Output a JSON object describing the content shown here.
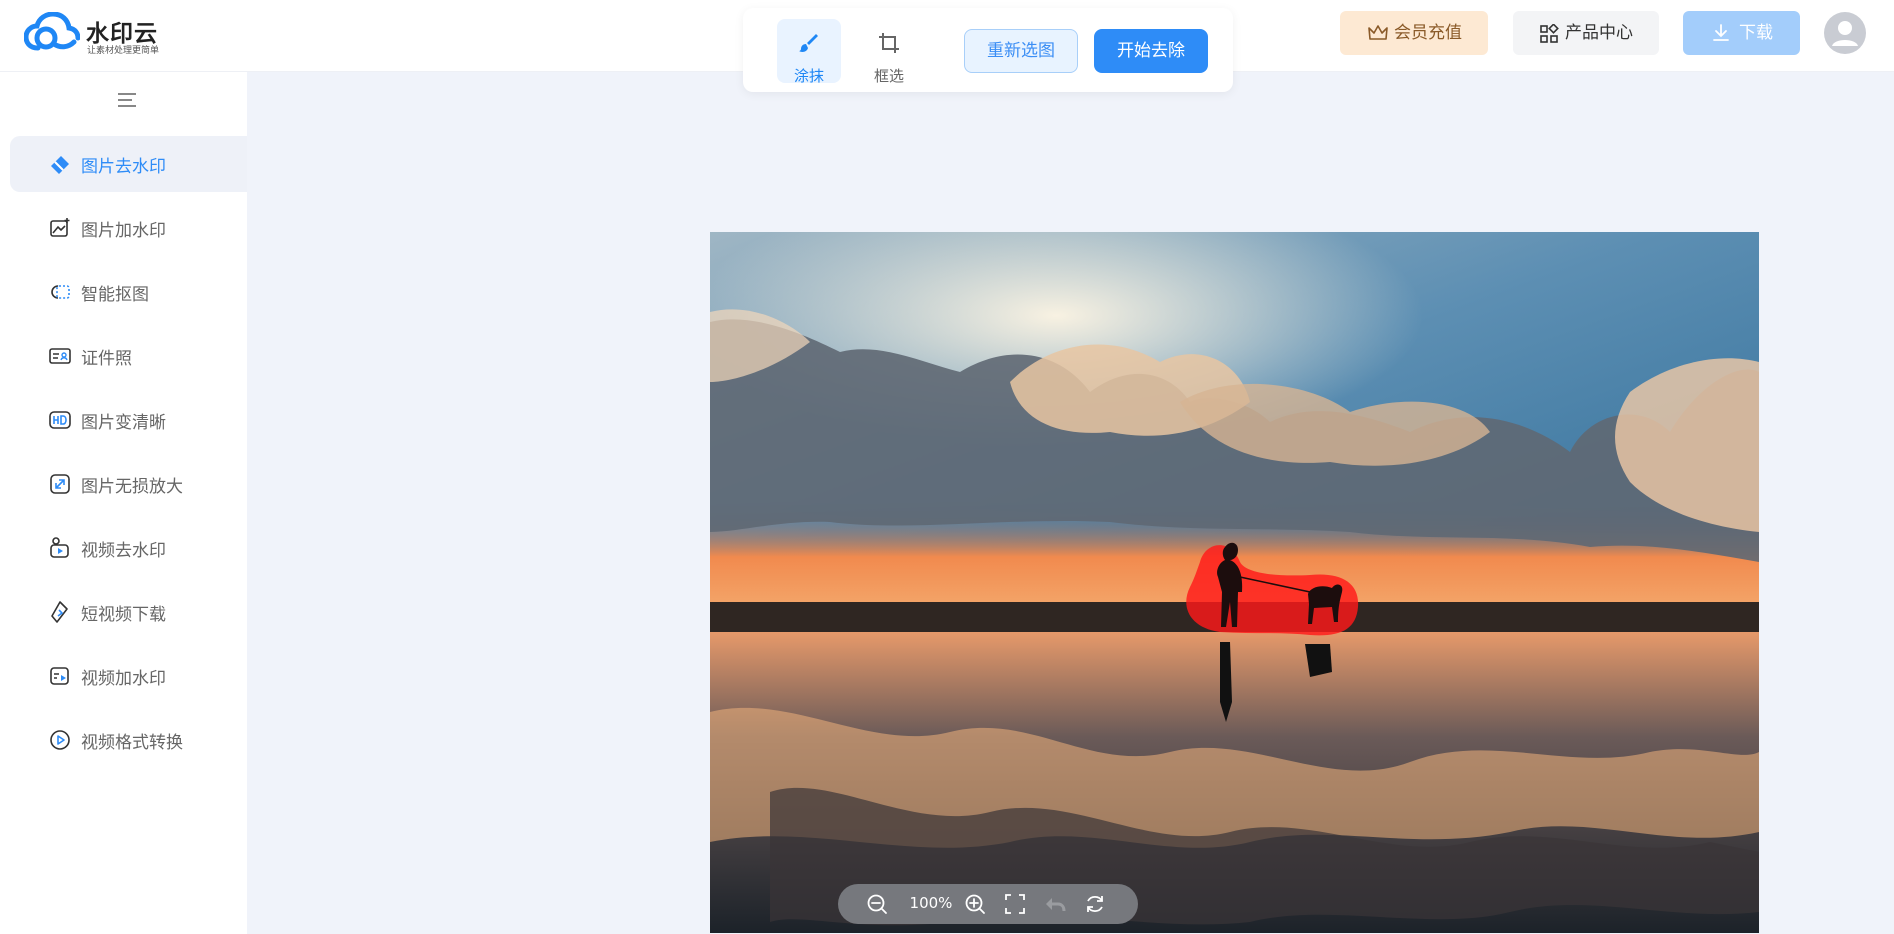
{
  "app": {
    "name": "水印云",
    "tagline": "让素材处理更简单"
  },
  "toolbar": {
    "tools": [
      {
        "label": "涂抹",
        "icon": "brush-icon",
        "active": true
      },
      {
        "label": "框选",
        "icon": "crop-icon",
        "active": false
      }
    ],
    "reselect_label": "重新选图",
    "start_label": "开始去除"
  },
  "header": {
    "vip_label": "会员充值",
    "products_label": "产品中心",
    "download_label": "下载"
  },
  "sidebar": {
    "items": [
      {
        "label": "图片去水印",
        "icon": "eraser-icon",
        "active": true
      },
      {
        "label": "图片加水印",
        "icon": "image-add-icon",
        "active": false
      },
      {
        "label": "智能抠图",
        "icon": "cutout-icon",
        "active": false
      },
      {
        "label": "证件照",
        "icon": "id-card-icon",
        "active": false
      },
      {
        "label": "图片变清晰",
        "icon": "hd-icon",
        "active": false
      },
      {
        "label": "图片无损放大",
        "icon": "enlarge-icon",
        "active": false
      },
      {
        "label": "视频去水印",
        "icon": "video-eraser-icon",
        "active": false
      },
      {
        "label": "短视频下载",
        "icon": "short-video-download-icon",
        "active": false
      },
      {
        "label": "视频加水印",
        "icon": "video-add-icon",
        "active": false
      },
      {
        "label": "视频格式转换",
        "icon": "video-convert-icon",
        "active": false
      }
    ]
  },
  "zoom": {
    "level": "100%"
  },
  "colors": {
    "accent": "#2e8cf7",
    "mask": "#ff1a1a"
  }
}
